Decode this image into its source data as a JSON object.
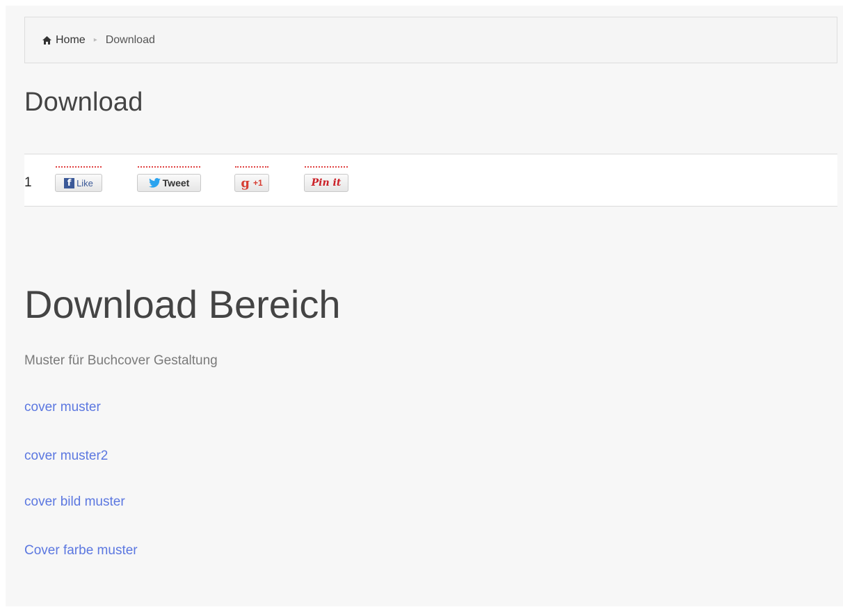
{
  "breadcrumb": {
    "home_label": "Home",
    "current_label": "Download",
    "separator": "▸"
  },
  "page_title": "Download",
  "share": {
    "count": "1",
    "like_label": "Like",
    "tweet_label": "Tweet",
    "plusone_label": "+1",
    "pin_label": "Pin it"
  },
  "section": {
    "title": "Download Bereich",
    "subtitle": "Muster für Buchcover Gestaltung",
    "links": [
      "cover muster",
      "cover muster2",
      "cover bild muster",
      "Cover farbe muster"
    ]
  },
  "colors": {
    "link": "#5b77e0",
    "background": "#f7f7f7"
  }
}
